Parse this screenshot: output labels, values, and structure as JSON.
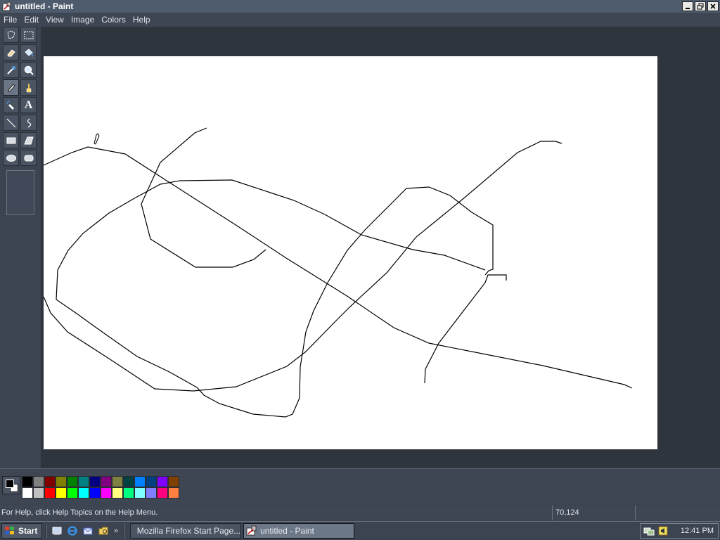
{
  "window": {
    "title": "untitled - Paint",
    "controls": [
      "minimize",
      "restore",
      "close"
    ]
  },
  "menu": [
    "File",
    "Edit",
    "View",
    "Image",
    "Colors",
    "Help"
  ],
  "tools": [
    {
      "name": "free-form-select-icon"
    },
    {
      "name": "rectangle-select-icon"
    },
    {
      "name": "eraser-icon"
    },
    {
      "name": "fill-bucket-icon"
    },
    {
      "name": "color-picker-icon"
    },
    {
      "name": "magnifier-icon"
    },
    {
      "name": "pencil-icon",
      "active": true
    },
    {
      "name": "brush-icon"
    },
    {
      "name": "airbrush-icon"
    },
    {
      "name": "text-icon",
      "glyph": "A"
    },
    {
      "name": "line-icon"
    },
    {
      "name": "curve-icon"
    },
    {
      "name": "rectangle-icon"
    },
    {
      "name": "polygon-icon"
    },
    {
      "name": "ellipse-icon"
    },
    {
      "name": "rounded-rectangle-icon"
    }
  ],
  "palette": {
    "foreground": "#000000",
    "background": "#ffffff",
    "colors": [
      "#000000",
      "#808080",
      "#800000",
      "#808000",
      "#008000",
      "#008080",
      "#000080",
      "#800080",
      "#808040",
      "#004040",
      "#0080ff",
      "#004080",
      "#8000ff",
      "#804000",
      "#ffffff",
      "#c0c0c0",
      "#ff0000",
      "#ffff00",
      "#00ff00",
      "#00ffff",
      "#0000ff",
      "#ff00ff",
      "#ffff80",
      "#00ff80",
      "#80ffff",
      "#8080ff",
      "#ff0080",
      "#ff8040"
    ]
  },
  "status": {
    "help_text": "For Help, click Help Topics on the Help Menu.",
    "coordinates": "70,124"
  },
  "taskbar": {
    "start_label": "Start",
    "quick_launch": [
      "show-desktop-icon",
      "internet-explorer-icon",
      "outlook-icon",
      "windows-explorer-icon"
    ],
    "more_indicator": "»",
    "tasks": [
      {
        "label": "Mozilla Firefox Start Page...",
        "icon": "firefox-icon",
        "active": false
      },
      {
        "label": "untitled - Paint",
        "icon": "paint-icon",
        "active": true
      }
    ],
    "tray_icons": [
      "network-icon",
      "volume-icon"
    ],
    "clock": "12:41 PM"
  }
}
